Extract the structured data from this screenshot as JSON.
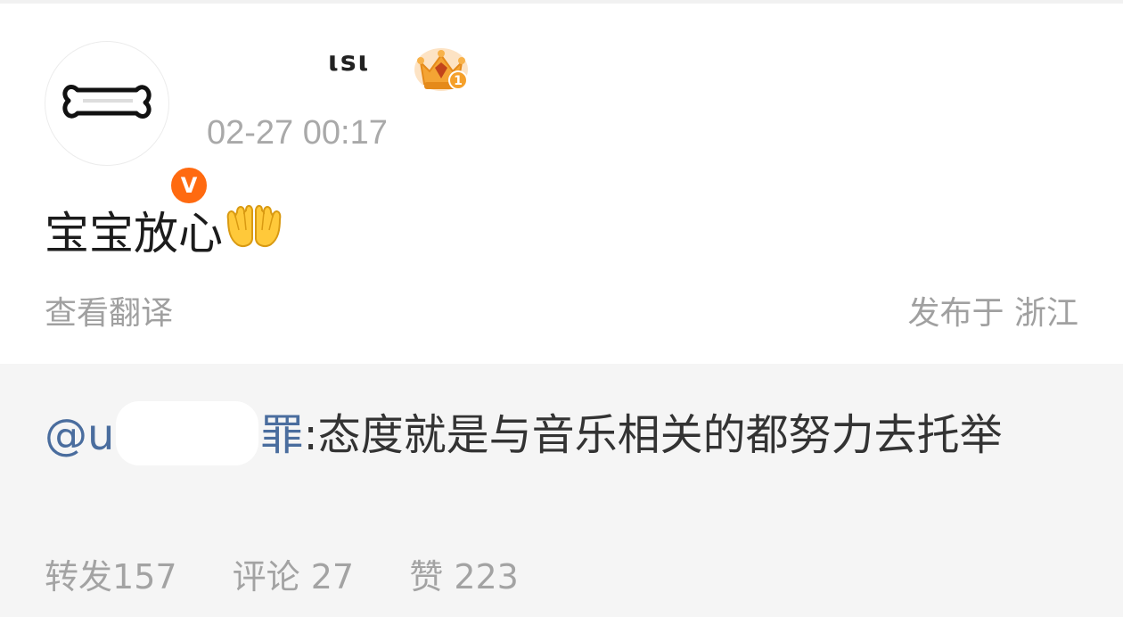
{
  "post": {
    "author": {
      "name": "ιsι",
      "verified_badge": "V",
      "crown_badge_number": "1",
      "avatar_icon": "bone-icon"
    },
    "timestamp": "02-27 00:17",
    "text": "宝宝放心",
    "emoji": "palms-up-together-icon",
    "translate_label": "查看翻译",
    "location": "发布于 浙江"
  },
  "repost": {
    "mention_prefix": "@",
    "mention_partial_start": "u",
    "mention_partial_end": "罪",
    "text": ":态度就是与音乐相关的都努力去托举",
    "stats": {
      "repost_label": "转发",
      "repost_count": "157",
      "comment_label": "评论",
      "comment_count": "27",
      "like_label": "赞",
      "like_count": "223"
    }
  },
  "colors": {
    "mention": "#4a6d9e",
    "verified": "#ff6a10",
    "muted_text": "#a0a0a0",
    "repost_bg": "#f5f5f5"
  }
}
